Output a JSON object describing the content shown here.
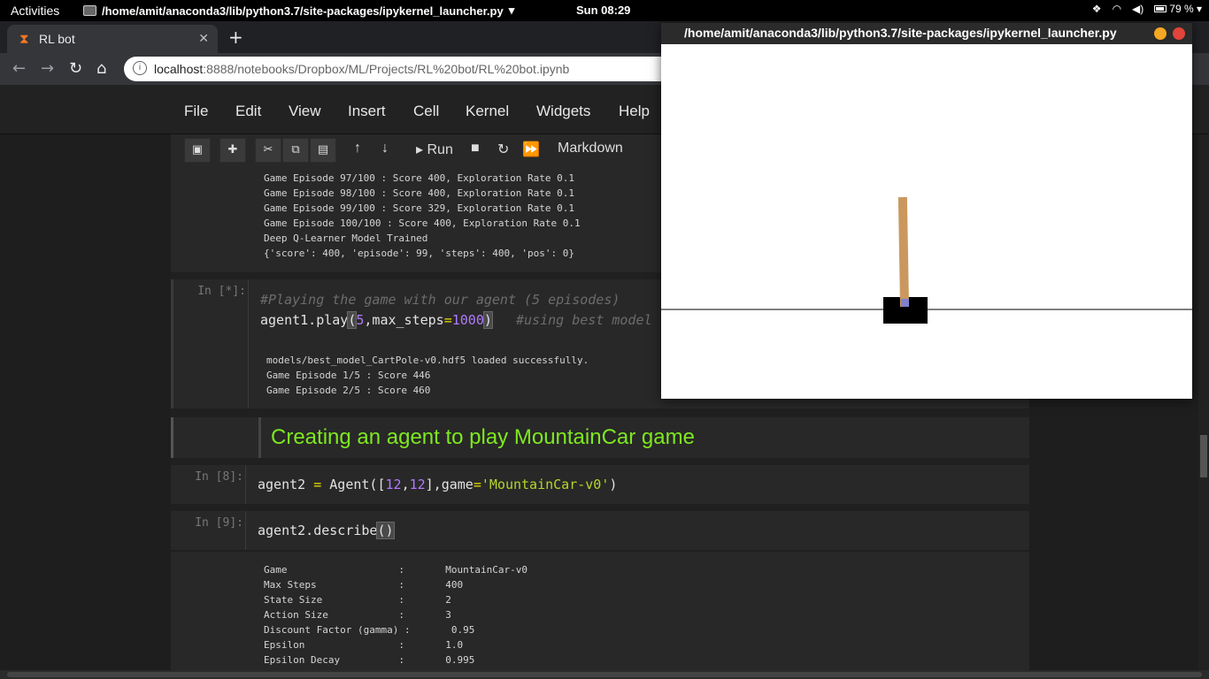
{
  "topbar": {
    "activities": "Activities",
    "app_title": "/home/amit/anaconda3/lib/python3.7/site-packages/ipykernel_launcher.py",
    "clock": "Sun 08:29",
    "battery": "79 %"
  },
  "browser": {
    "tab_title": "RL bot",
    "url_host": "localhost",
    "url_path": ":8888/notebooks/Dropbox/ML/Projects/RL%20bot/RL%20bot.ipynb"
  },
  "menu": [
    "File",
    "Edit",
    "View",
    "Insert",
    "Cell",
    "Kernel",
    "Widgets",
    "Help"
  ],
  "toolbar": {
    "run_label": "Run",
    "cell_type": "Markdown"
  },
  "cells": {
    "out1": "Game Episode 97/100 : Score 400, Exploration Rate 0.1\nGame Episode 98/100 : Score 400, Exploration Rate 0.1\nGame Episode 99/100 : Score 329, Exploration Rate 0.1\nGame Episode 100/100 : Score 400, Exploration Rate 0.1\nDeep Q-Learner Model Trained\n{'score': 400, 'episode': 99, 'steps': 400, 'pos': 0}",
    "prompt_running": "In [*]:",
    "play_comment": "#Playing the game with our agent (5 episodes)",
    "play_obj": "agent1.play",
    "play_arg1": "5",
    "play_kw": ",max_steps",
    "play_arg2": "1000",
    "play_comment2": "#using best model",
    "out2": "models/best_model_CartPole-v0.hdf5 loaded successfully.\nGame Episode 1/5 : Score 446\nGame Episode 2/5 : Score 460",
    "heading": "Creating an agent to play MountainCar game",
    "prompt_8": "In [8]:",
    "agent2_lhs": "agent2 ",
    "agent2_call": " Agent([",
    "agent2_n1": "12",
    "agent2_n2": "12",
    "agent2_kw": "],game",
    "agent2_str": "'MountainCar-v0'",
    "agent2_close": ")",
    "prompt_9": "In [9]:",
    "describe": "agent2.describe",
    "out3": "Game                   :       MountainCar-v0\nMax Steps              :       400\nState Size             :       2\nAction Size            :       3\nDiscount Factor (gamma) :       0.95\nEpsilon                :       1.0\nEpsilon Decay          :       0.995"
  },
  "gym_window": {
    "title": "/home/amit/anaconda3/lib/python3.7/site-packages/ipykernel_launcher.py"
  },
  "colors": {
    "heading": "#7ee81f",
    "pole": "#ca985f",
    "axle": "#8080cc",
    "cart": "#000000"
  },
  "icons": [
    "dropbox-icon",
    "wifi-icon",
    "volume-icon",
    "battery-icon",
    "hourglass-icon",
    "info-icon",
    "save-icon",
    "plus-icon",
    "scissors-icon",
    "copy-icon",
    "paste-icon",
    "arrow-up-icon",
    "arrow-down-icon",
    "stop-icon",
    "restart-icon",
    "fast-forward-icon"
  ]
}
